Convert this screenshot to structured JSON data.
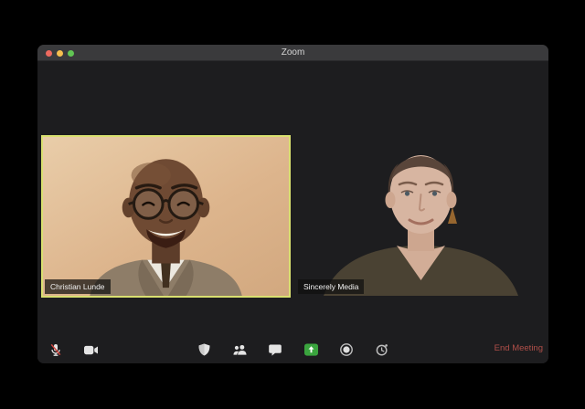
{
  "window": {
    "title": "Zoom"
  },
  "titlebar": {
    "traffic_lights": [
      {
        "name": "close",
        "color": "#ee6a5f"
      },
      {
        "name": "minimize",
        "color": "#f5bf4f"
      },
      {
        "name": "zoom",
        "color": "#61c554"
      }
    ]
  },
  "participants": [
    {
      "name": "Christian Lunde",
      "active_speaker": true
    },
    {
      "name": "Sincerely Media",
      "active_speaker": false
    }
  ],
  "toolbar": {
    "items": [
      {
        "name": "mute",
        "icon": "mic-muted-icon",
        "state": "muted"
      },
      {
        "name": "video",
        "icon": "video-camera-icon",
        "state": "on"
      },
      {
        "name": "security",
        "icon": "shield-icon"
      },
      {
        "name": "participants",
        "icon": "participants-icon"
      },
      {
        "name": "chat",
        "icon": "chat-bubble-icon"
      },
      {
        "name": "share-screen",
        "icon": "share-screen-icon",
        "color": "#3aa43e"
      },
      {
        "name": "record",
        "icon": "record-icon"
      },
      {
        "name": "timer",
        "icon": "timer-icon"
      }
    ],
    "end_meeting_label": "End Meeting"
  },
  "colors": {
    "active_speaker_border": "#d9e070",
    "share_screen_green": "#3aa43e",
    "end_meeting_red": "#b04f49",
    "window_chrome": "#3a3a3c",
    "window_background": "#1d1d1f"
  }
}
